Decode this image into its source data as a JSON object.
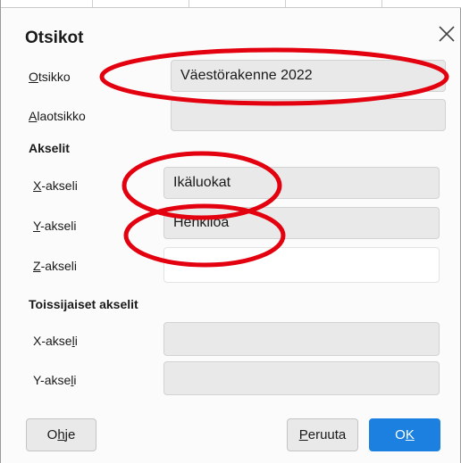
{
  "dialog": {
    "title": "Otsikot",
    "close_icon": "close-icon"
  },
  "fields": {
    "otsikko": {
      "label_u": "O",
      "label_rest": "tsikko",
      "value": "Väestörakenne 2022"
    },
    "alaotsikko": {
      "label_u": "A",
      "label_rest": "laotsikko",
      "value": ""
    }
  },
  "akselit": {
    "heading": "Akselit",
    "x": {
      "label_u": "X",
      "label_rest": "-akseli",
      "value": "Ikäluokat"
    },
    "y": {
      "label_u": "Y",
      "label_rest": "-akseli",
      "value": "Henkilöä"
    },
    "z": {
      "label_u": "Z",
      "label_rest": "-akseli",
      "value": ""
    }
  },
  "toissijaiset": {
    "heading": "Toissijaiset akselit",
    "x": {
      "label_pre": "X-akse",
      "label_u": "l",
      "label_post": "i",
      "value": ""
    },
    "y": {
      "label_pre": "Y-akse",
      "label_u": "l",
      "label_post": "i",
      "value": ""
    }
  },
  "buttons": {
    "help": {
      "pre": "O",
      "u": "h",
      "post": "je"
    },
    "cancel": {
      "u": "P",
      "post": "eruuta"
    },
    "ok": {
      "pre": "O",
      "u": "K"
    }
  },
  "annotation_color": "#e3000f"
}
